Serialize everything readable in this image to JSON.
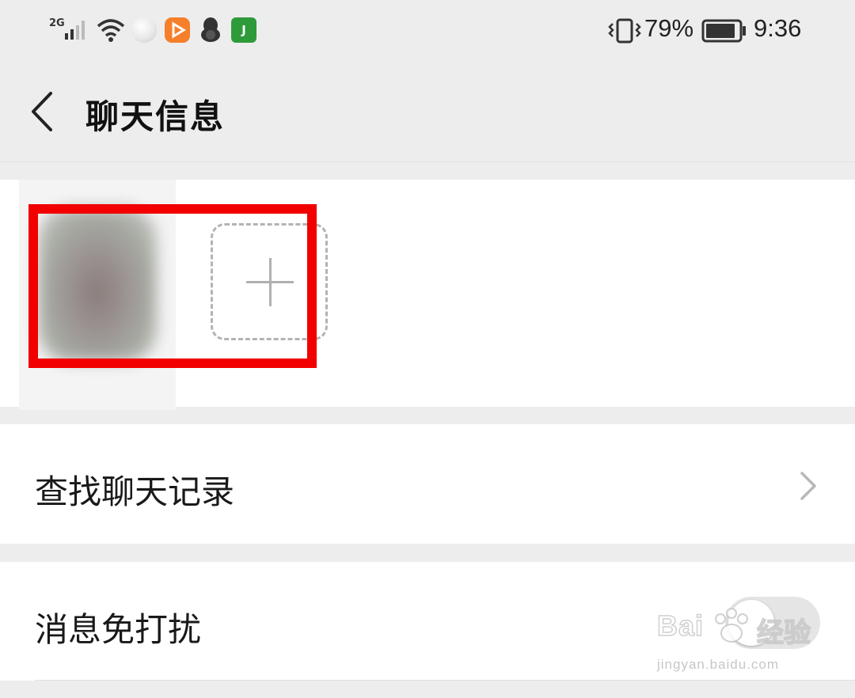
{
  "status_bar": {
    "network_type": "2G",
    "battery_percent": "79%",
    "time": "9:36",
    "app_icons": [
      "circle-app-icon",
      "video-play-app-icon",
      "qq-penguin-icon",
      "green-app-icon"
    ],
    "app4_glyph": "J"
  },
  "header": {
    "title": "聊天信息",
    "back_icon": "chevron-left-icon"
  },
  "members": {
    "add_icon": "plus-icon",
    "highlight_color": "#f20000"
  },
  "settings": {
    "search_history_label": "查找聊天记录",
    "mute_label": "消息免打扰",
    "mute_enabled": false
  },
  "watermark": {
    "brand": "Bai",
    "brand_suffix": "经验",
    "url": "jingyan.baidu.com"
  },
  "colors": {
    "background": "#ededed",
    "card": "#ffffff",
    "highlight": "#f20000"
  }
}
